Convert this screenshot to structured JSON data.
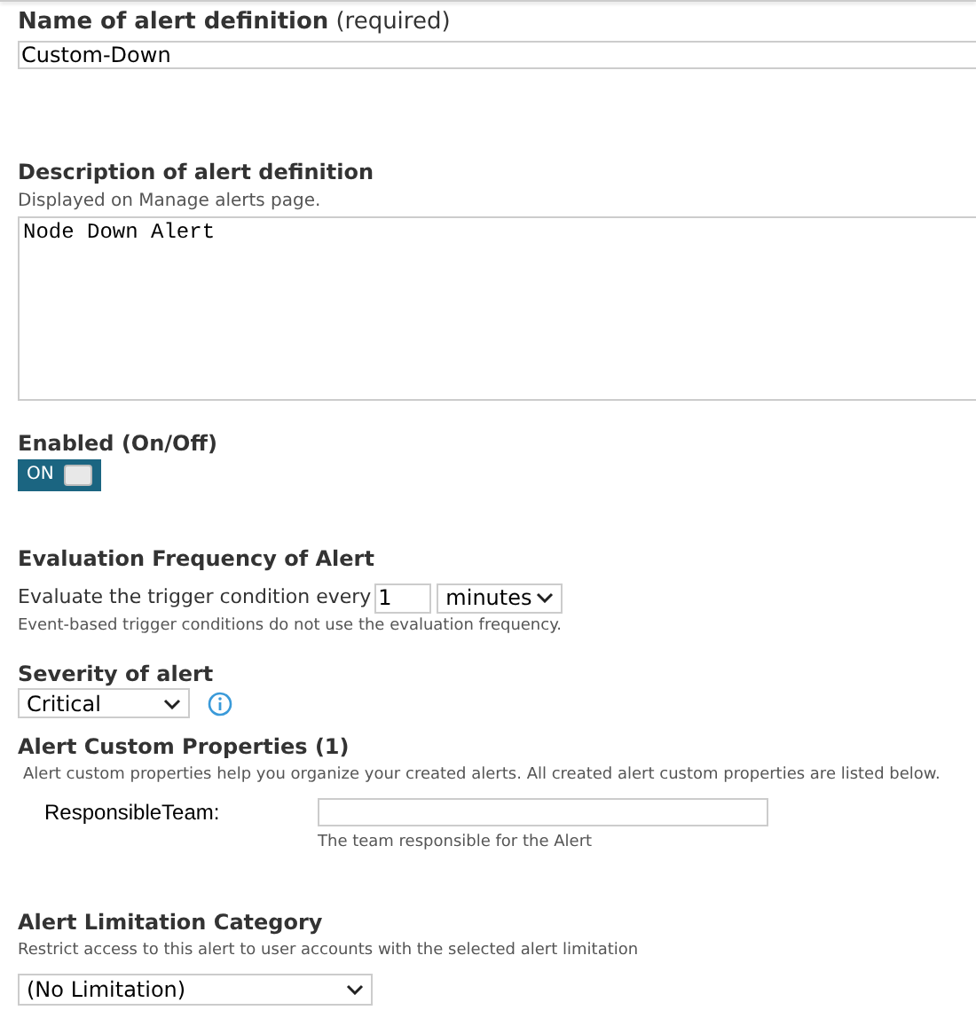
{
  "name_field": {
    "label": "Name of alert definition",
    "note": "(required)",
    "value": "Custom-Down"
  },
  "description": {
    "label": "Description of alert definition",
    "hint": "Displayed on Manage alerts page.",
    "value": "Node Down Alert"
  },
  "enabled": {
    "label": "Enabled (On/Off)",
    "on": true,
    "text": "ON"
  },
  "frequency": {
    "heading": "Evaluation Frequency of Alert",
    "label": "Evaluate the trigger condition every",
    "value": "1",
    "unit": "minutes",
    "note": "Event-based trigger conditions do not use the evaluation frequency."
  },
  "severity": {
    "heading": "Severity of alert",
    "value": "Critical"
  },
  "custom_properties": {
    "heading": "Alert Custom Properties (1)",
    "description": "Alert custom properties help you organize your created alerts. All created alert custom properties are listed below.",
    "properties": [
      {
        "name": "ResponsibleTeam:",
        "hint": "The team responsible for the Alert"
      }
    ]
  },
  "limitation": {
    "heading": "Alert Limitation Category",
    "description": "Restrict access to this alert to user accounts with the selected alert limitation",
    "value": "(No Limitation)"
  }
}
